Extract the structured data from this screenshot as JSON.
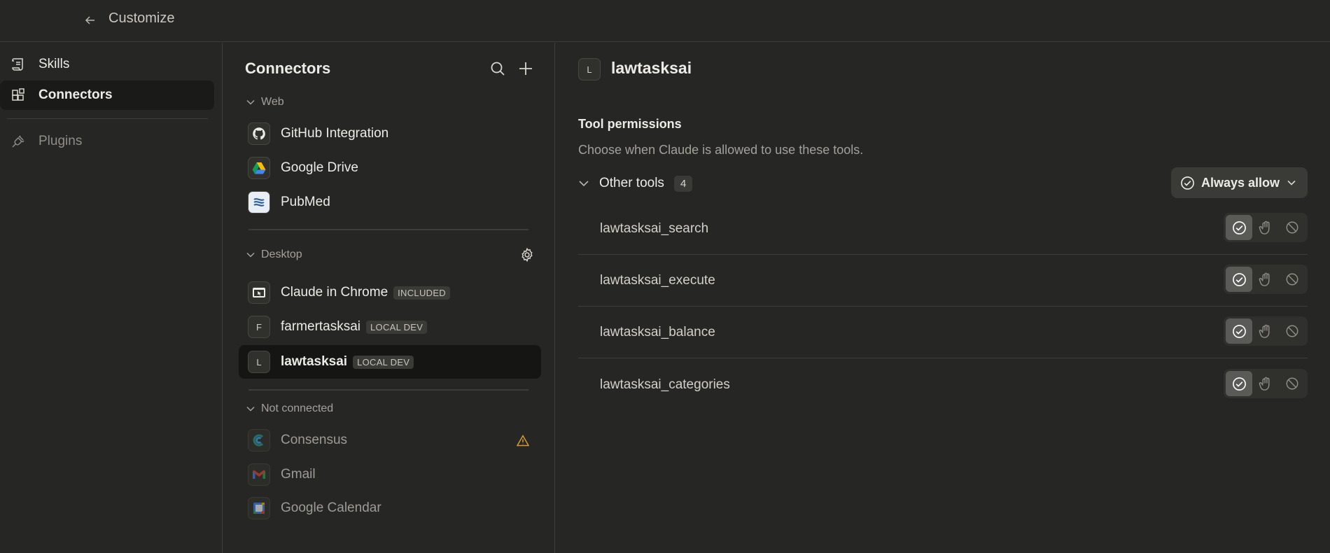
{
  "topbar": {
    "title": "Customize"
  },
  "sidebar": {
    "items": [
      {
        "label": "Skills",
        "icon": "scroll-icon"
      },
      {
        "label": "Connectors",
        "icon": "connectors-icon",
        "active": true
      },
      {
        "label": "Plugins",
        "icon": "plug-icon"
      }
    ]
  },
  "connectors": {
    "title": "Connectors",
    "sections": {
      "web": "Web",
      "desktop": "Desktop",
      "not_connected": "Not connected"
    },
    "web_items": [
      {
        "label": "GitHub Integration",
        "icon": "github-icon"
      },
      {
        "label": "Google Drive",
        "icon": "google-drive-icon"
      },
      {
        "label": "PubMed",
        "icon": "pubmed-icon"
      }
    ],
    "desktop_items": [
      {
        "label": "Claude in Chrome",
        "badge": "INCLUDED",
        "icon": "chrome-cursor-icon"
      },
      {
        "label": "farmertasksai",
        "badge": "LOCAL DEV",
        "letter": "F"
      },
      {
        "label": "lawtasksai",
        "badge": "LOCAL DEV",
        "letter": "L",
        "selected": true
      }
    ],
    "not_connected_items": [
      {
        "label": "Consensus",
        "icon": "consensus-icon",
        "warning": true
      },
      {
        "label": "Gmail",
        "icon": "gmail-icon"
      },
      {
        "label": "Google Calendar",
        "icon": "google-calendar-icon"
      }
    ]
  },
  "detail": {
    "letter": "L",
    "title": "lawtasksai",
    "permissions_title": "Tool permissions",
    "permissions_desc": "Choose when Claude is allowed to use these tools.",
    "group_label": "Other tools",
    "group_count": "4",
    "group_permission": "Always allow",
    "tools": [
      {
        "name": "lawtasksai_search",
        "permission": "always"
      },
      {
        "name": "lawtasksai_execute",
        "permission": "always"
      },
      {
        "name": "lawtasksai_balance",
        "permission": "always"
      },
      {
        "name": "lawtasksai_categories",
        "permission": "always"
      }
    ]
  },
  "colors": {
    "background": "#262624",
    "selected_bg": "#151513",
    "warning": "#d69a2e"
  }
}
